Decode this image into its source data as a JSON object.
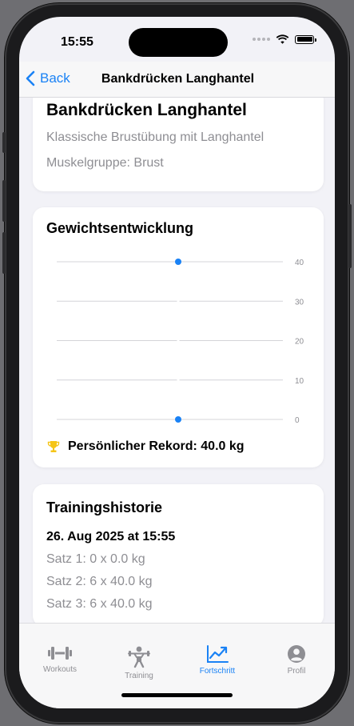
{
  "status": {
    "time": "15:55"
  },
  "nav": {
    "back_label": "Back",
    "title": "Bankdrücken Langhantel"
  },
  "exercise": {
    "name": "Bankdrücken Langhantel",
    "description": "Klassische Brustübung mit Langhantel",
    "muscle_group": "Muskelgruppe: Brust"
  },
  "progress": {
    "title": "Gewichtsentwicklung",
    "record_label": "Persönlicher Rekord: 40.0 kg"
  },
  "chart_data": {
    "type": "line",
    "y_ticks": [
      "40",
      "30",
      "20",
      "10",
      "0"
    ],
    "ylim": [
      0,
      40
    ],
    "series": [
      {
        "values": [
          0,
          40
        ]
      }
    ],
    "grid": true,
    "accent": "#1a82f5"
  },
  "history": {
    "title": "Trainingshistorie",
    "date": "26. Aug 2025 at 15:55",
    "sets": [
      "Satz 1: 0 x 0.0 kg",
      "Satz 2: 6 x 40.0 kg",
      "Satz 3: 6 x 40.0 kg"
    ]
  },
  "tabs": [
    {
      "label": "Workouts",
      "icon": "dumbbell-icon",
      "active": false
    },
    {
      "label": "Training",
      "icon": "weightlifter-icon",
      "active": false
    },
    {
      "label": "Fortschritt",
      "icon": "chart-line-icon",
      "active": true
    },
    {
      "label": "Profil",
      "icon": "person-circle-icon",
      "active": false
    }
  ],
  "colors": {
    "accent": "#1a82f5",
    "secondary_text": "#8e8e93",
    "background": "#f2f2f7",
    "trophy": "#f5c518"
  }
}
